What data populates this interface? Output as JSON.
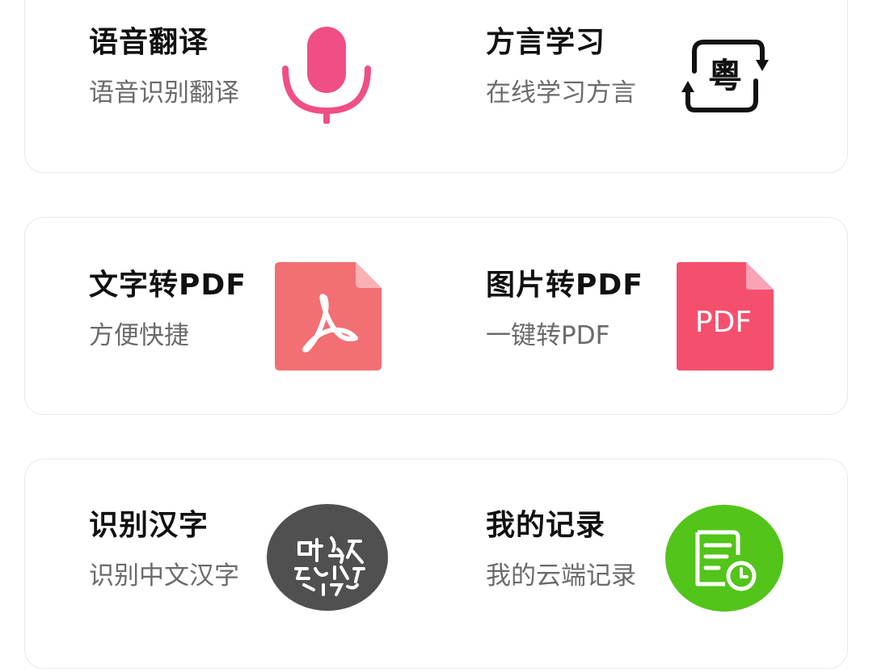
{
  "cards": [
    {
      "tiles": [
        {
          "title": "语音翻译",
          "subtitle": "语音识别翻译",
          "icon": "microphone-icon",
          "icon_color": "#f04f86"
        },
        {
          "title": "方言学习",
          "subtitle": "在线学习方言",
          "icon": "cantonese-character-icon",
          "icon_text": "粵",
          "icon_color": "#111111"
        }
      ]
    },
    {
      "tiles": [
        {
          "title": "文字转PDF",
          "subtitle": "方便快捷",
          "icon": "acrobat-pdf-icon",
          "icon_color": "#f26f73"
        },
        {
          "title": "图片转PDF",
          "subtitle": "一键转PDF",
          "icon": "pdf-file-icon",
          "icon_text": "PDF",
          "icon_color": "#f4506e"
        }
      ]
    },
    {
      "tiles": [
        {
          "title": "识别汉字",
          "subtitle": "识别中文汉字",
          "icon": "chinese-characters-icon",
          "icon_color": "#505050"
        },
        {
          "title": "我的记录",
          "subtitle": "我的云端记录",
          "icon": "cloud-record-icon",
          "icon_color": "#52c41a"
        }
      ]
    }
  ]
}
